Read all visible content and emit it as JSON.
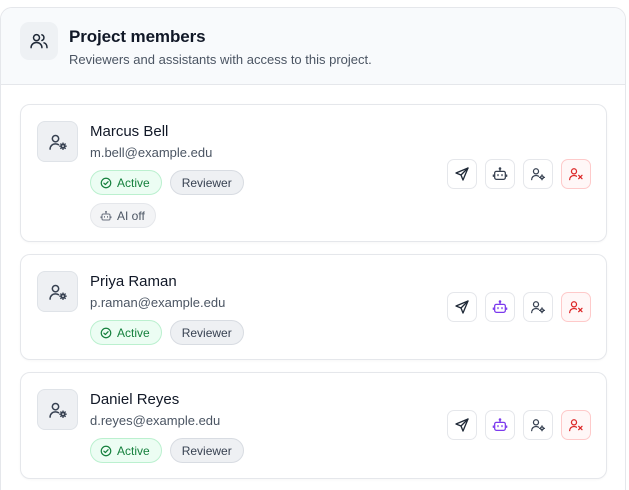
{
  "header": {
    "title": "Project members",
    "subtitle": "Reviewers and assistants with access to this project.",
    "icon": "users-icon"
  },
  "members": [
    {
      "name": "Marcus Bell",
      "email": "m.bell@example.edu",
      "status": "Active",
      "role": "Reviewer",
      "ai_badge": "AI off",
      "ai_enabled": false
    },
    {
      "name": "Priya Raman",
      "email": "p.raman@example.edu",
      "status": "Active",
      "role": "Reviewer",
      "ai_enabled": true
    },
    {
      "name": "Daniel Reyes",
      "email": "d.reyes@example.edu",
      "status": "Active",
      "role": "Reviewer",
      "ai_enabled": true
    }
  ],
  "colors": {
    "active_green": "#15803d",
    "danger_red": "#dc2626",
    "ai_purple": "#7c3aed",
    "muted_gray": "#374151"
  }
}
